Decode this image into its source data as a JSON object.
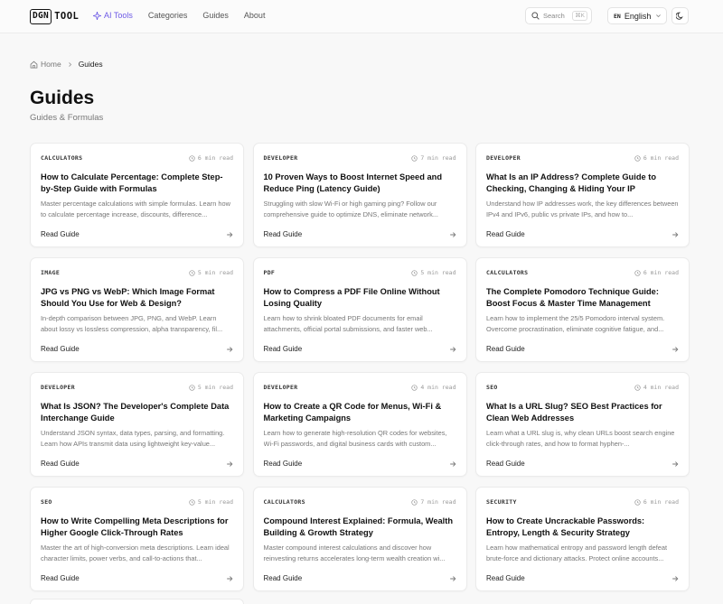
{
  "header": {
    "logo_box": "DGN",
    "logo_text": "TOOL",
    "nav": [
      {
        "label": "AI Tools",
        "active": true
      },
      {
        "label": "Categories"
      },
      {
        "label": "Guides"
      },
      {
        "label": "About"
      }
    ],
    "search": {
      "label": "Search",
      "shortcut": "⌘K"
    },
    "language": {
      "code": "EN",
      "label": "English"
    },
    "theme_icon": "moon-icon"
  },
  "breadcrumb": {
    "home": "Home",
    "current": "Guides"
  },
  "page": {
    "title": "Guides",
    "subtitle": "Guides & Formulas"
  },
  "cards": [
    {
      "category": "CALCULATORS",
      "read_time": "6 min read",
      "title": "How to Calculate Percentage: Complete Step-by-Step Guide with Formulas",
      "desc": "Master percentage calculations with simple formulas. Learn how to calculate percentage increase, discounts, difference...",
      "cta": "Read Guide"
    },
    {
      "category": "DEVELOPER",
      "read_time": "7 min read",
      "title": "10 Proven Ways to Boost Internet Speed and Reduce Ping (Latency Guide)",
      "desc": "Struggling with slow Wi-Fi or high gaming ping? Follow our comprehensive guide to optimize DNS, eliminate network...",
      "cta": "Read Guide"
    },
    {
      "category": "DEVELOPER",
      "read_time": "6 min read",
      "title": "What Is an IP Address? Complete Guide to Checking, Changing & Hiding Your IP",
      "desc": "Understand how IP addresses work, the key differences between IPv4 and IPv6, public vs private IPs, and how to...",
      "cta": "Read Guide"
    },
    {
      "category": "IMAGE",
      "read_time": "5 min read",
      "title": "JPG vs PNG vs WebP: Which Image Format Should You Use for Web & Design?",
      "desc": "In-depth comparison between JPG, PNG, and WebP. Learn about lossy vs lossless compression, alpha transparency, fil...",
      "cta": "Read Guide"
    },
    {
      "category": "PDF",
      "read_time": "5 min read",
      "title": "How to Compress a PDF File Online Without Losing Quality",
      "desc": "Learn how to shrink bloated PDF documents for email attachments, official portal submissions, and faster web...",
      "cta": "Read Guide"
    },
    {
      "category": "CALCULATORS",
      "read_time": "6 min read",
      "title": "The Complete Pomodoro Technique Guide: Boost Focus & Master Time Management",
      "desc": "Learn how to implement the 25/5 Pomodoro interval system. Overcome procrastination, eliminate cognitive fatigue, and...",
      "cta": "Read Guide"
    },
    {
      "category": "DEVELOPER",
      "read_time": "5 min read",
      "title": "What Is JSON? The Developer's Complete Data Interchange Guide",
      "desc": "Understand JSON syntax, data types, parsing, and formatting. Learn how APIs transmit data using lightweight key-value...",
      "cta": "Read Guide"
    },
    {
      "category": "DEVELOPER",
      "read_time": "4 min read",
      "title": "How to Create a QR Code for Menus, Wi-Fi & Marketing Campaigns",
      "desc": "Learn how to generate high-resolution QR codes for websites, Wi-Fi passwords, and digital business cards with custom...",
      "cta": "Read Guide"
    },
    {
      "category": "SEO",
      "read_time": "4 min read",
      "title": "What Is a URL Slug? SEO Best Practices for Clean Web Addresses",
      "desc": "Learn what a URL slug is, why clean URLs boost search engine click-through rates, and how to format hyphen-...",
      "cta": "Read Guide"
    },
    {
      "category": "SEO",
      "read_time": "5 min read",
      "title": "How to Write Compelling Meta Descriptions for Higher Google Click-Through Rates",
      "desc": "Master the art of high-conversion meta descriptions. Learn ideal character limits, power verbs, and call-to-actions that...",
      "cta": "Read Guide"
    },
    {
      "category": "CALCULATORS",
      "read_time": "7 min read",
      "title": "Compound Interest Explained: Formula, Wealth Building & Growth Strategy",
      "desc": "Master compound interest calculations and discover how reinvesting returns accelerates long-term wealth creation wi...",
      "cta": "Read Guide"
    },
    {
      "category": "SECURITY",
      "read_time": "6 min read",
      "title": "How to Create Uncrackable Passwords: Entropy, Length & Security Strategy",
      "desc": "Learn how mathematical entropy and password length defeat brute-force and dictionary attacks. Protect online accounts...",
      "cta": "Read Guide"
    }
  ]
}
